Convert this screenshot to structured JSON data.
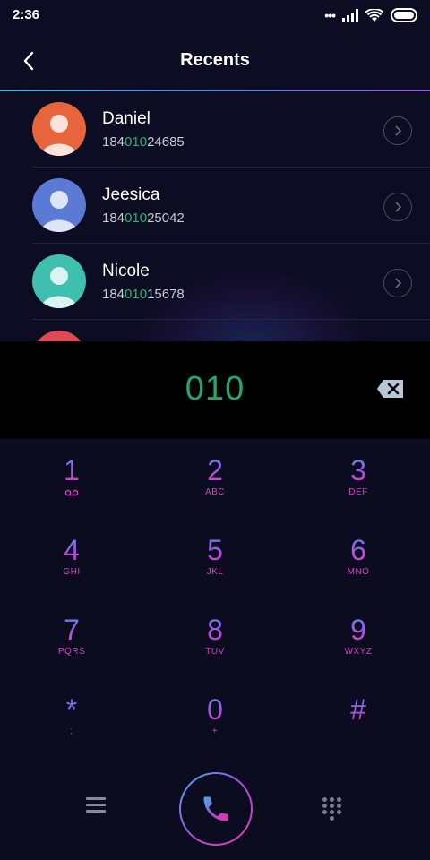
{
  "status": {
    "time": "2:36"
  },
  "header": {
    "title": "Recents"
  },
  "recents": [
    {
      "name": "Daniel",
      "number_prefix": "184",
      "number_match": "010",
      "number_suffix": "24685",
      "avatar_color": "#e8643c"
    },
    {
      "name": "Jeesica",
      "number_prefix": "184",
      "number_match": "010",
      "number_suffix": "25042",
      "avatar_color": "#5b7ad6"
    },
    {
      "name": "Nicole",
      "number_prefix": "184",
      "number_match": "010",
      "number_suffix": "15678",
      "avatar_color": "#3fbfb0"
    },
    {
      "name": "",
      "number_prefix": "",
      "number_match": "",
      "number_suffix": "",
      "avatar_color": "#e04858"
    }
  ],
  "input": {
    "digits": "010"
  },
  "keypad": [
    {
      "digit": "1",
      "letters": "",
      "icon": "voicemail-icon"
    },
    {
      "digit": "2",
      "letters": "ABC"
    },
    {
      "digit": "3",
      "letters": "DEF"
    },
    {
      "digit": "4",
      "letters": "GHI"
    },
    {
      "digit": "5",
      "letters": "JKL"
    },
    {
      "digit": "6",
      "letters": "MNO"
    },
    {
      "digit": "7",
      "letters": "PQRS"
    },
    {
      "digit": "8",
      "letters": "TUV"
    },
    {
      "digit": "9",
      "letters": "WXYZ"
    },
    {
      "digit": "*",
      "letters": ";"
    },
    {
      "digit": "0",
      "letters": "+"
    },
    {
      "digit": "#",
      "letters": ""
    }
  ],
  "colors": {
    "match": "#21b872",
    "input_digits": "#21a86a",
    "accent_blue": "#4a8ff0",
    "accent_pink": "#e23fb8"
  },
  "icons": {
    "back": "back-arrow-icon",
    "chevron": "chevron-right-icon",
    "delete": "backspace-icon",
    "menu": "menu-icon",
    "call": "phone-icon",
    "dialpad": "dialpad-icon"
  }
}
